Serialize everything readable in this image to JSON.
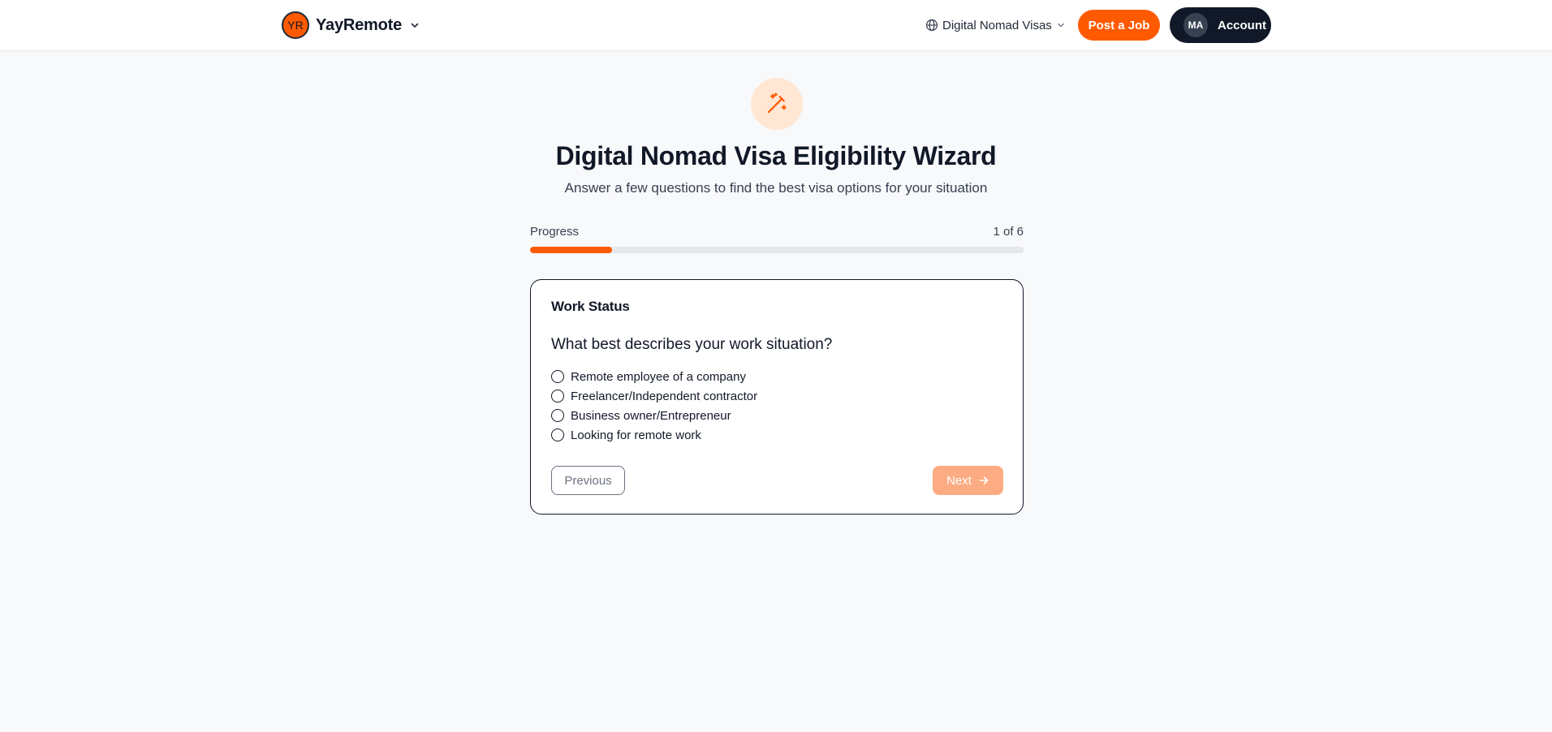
{
  "header": {
    "logo_initials": "YR",
    "brand_name": "YayRemote",
    "nav_visas_label": "Digital Nomad Visas",
    "post_job_label": "Post a Job",
    "account_initials": "MA",
    "account_label": "Account"
  },
  "hero": {
    "icon": "magic-wand-icon",
    "title": "Digital Nomad Visa Eligibility Wizard",
    "subtitle": "Answer a few questions to find the best visa options for your situation"
  },
  "progress": {
    "label": "Progress",
    "count_text": "1 of 6",
    "fraction": 0.1667
  },
  "wizard": {
    "step_title": "Work Status",
    "question": "What best describes your work situation?",
    "options": [
      {
        "label": "Remote employee of a company",
        "selected": false
      },
      {
        "label": "Freelancer/Independent contractor",
        "selected": false
      },
      {
        "label": "Business owner/Entrepreneur",
        "selected": false
      },
      {
        "label": "Looking for remote work",
        "selected": false
      }
    ],
    "previous_label": "Previous",
    "next_label": "Next"
  },
  "colors": {
    "accent": "#ff5a00",
    "accent_light": "#ffe7d3",
    "next_disabled": "#fdab82",
    "dark": "#111827"
  }
}
